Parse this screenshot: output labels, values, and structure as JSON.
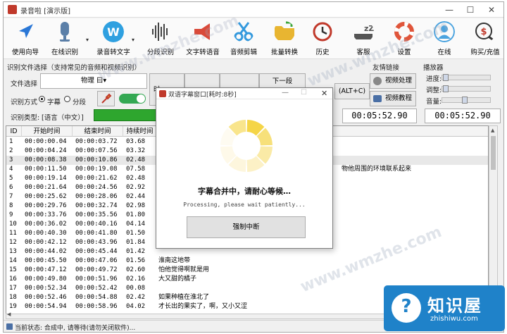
{
  "window": {
    "title": "录音啦 [演示版]",
    "controls": [
      "—",
      "☐",
      "✕"
    ]
  },
  "toolbar": [
    {
      "label": "使用向导",
      "color": "#2a77d6",
      "icon": "compass-icon"
    },
    {
      "label": "在线识别",
      "color": "#5b7fa8",
      "icon": "microphone-icon"
    },
    {
      "label": "录音转文字",
      "color": "#2fa0e0",
      "icon": "w-logo-icon"
    },
    {
      "label": "分段识别",
      "color": "#444444",
      "icon": "waveform-icon"
    },
    {
      "label": "文字转语音",
      "color": "#d94a3a",
      "icon": "megaphone-icon"
    },
    {
      "label": "音频剪辑",
      "color": "#3399dd",
      "icon": "scissors-icon"
    },
    {
      "label": "批量转换",
      "color": "#e8b531",
      "icon": "folder-icon"
    },
    {
      "label": "历史",
      "color": "#c0392b",
      "icon": "history-icon"
    },
    {
      "label": "客服",
      "color": "#555555",
      "icon": "sleep-zzz-icon"
    },
    {
      "label": "设置",
      "color": "#e0553a",
      "icon": "lifebuoy-icon"
    },
    {
      "label": "在线",
      "color": "#4aa3df",
      "icon": "user-icon"
    },
    {
      "label": "购买/充值",
      "color": "#c0392b",
      "icon": "payment-icon"
    }
  ],
  "panels": {
    "recognition_group": "识别文件选择（支持常见的音频和视频识别）",
    "file_label": "文件选择",
    "file_value": "物理 曰▾",
    "mode_label": "识别方式",
    "mode_subtitle": "字幕",
    "mode_segment": "分段",
    "type_label": "识别类型:",
    "type_value": "[语言（中文）]",
    "prev_btn": "下一段（ALT+X）",
    "next_btn": "(ALT+C)",
    "time_label": "时",
    "friends_group": "友情链接",
    "video_process": "视频处理",
    "video_tutorial": "视频教程",
    "player_group": "播放器",
    "progress_label": "进度:",
    "adjust_label": "调整:",
    "volume_label": "音量:",
    "time1": "00:05:52.90",
    "time2": "00:05:52.90"
  },
  "table": {
    "headers": [
      "ID",
      "开始时间",
      "结束时间",
      "持续时间"
    ],
    "rows": [
      [
        "1",
        "00:00:00.04",
        "00:00:03.72",
        "03.68",
        ""
      ],
      [
        "2",
        "00:00:04.24",
        "00:00:07.56",
        "03.32",
        ""
      ],
      [
        "3",
        "00:00:08.38",
        "00:00:10.86",
        "02.48",
        ""
      ],
      [
        "4",
        "00:00:11.50",
        "00:00:19.08",
        "07.58",
        "物他周围的环境联系起来"
      ],
      [
        "5",
        "00:00:19.14",
        "00:00:21.62",
        "02.48",
        ""
      ],
      [
        "6",
        "00:00:21.64",
        "00:00:24.56",
        "02.92",
        ""
      ],
      [
        "7",
        "00:00:25.62",
        "00:00:28.06",
        "02.44",
        ""
      ],
      [
        "8",
        "00:00:29.76",
        "00:00:32.74",
        "02.98",
        ""
      ],
      [
        "9",
        "00:00:33.76",
        "00:00:35.56",
        "01.80",
        ""
      ],
      [
        "10",
        "00:00:36.02",
        "00:00:40.16",
        "04.14",
        ""
      ],
      [
        "11",
        "00:00:40.30",
        "00:00:41.80",
        "01.50",
        ""
      ],
      [
        "12",
        "00:00:42.12",
        "00:00:43.96",
        "01.84",
        ""
      ],
      [
        "13",
        "00:00:44.02",
        "00:00:45.44",
        "01.42",
        ""
      ],
      [
        "14",
        "00:00:45.50",
        "00:00:47.06",
        "01.56",
        "淮南这地带"
      ],
      [
        "15",
        "00:00:47.12",
        "00:00:49.72",
        "02.60",
        "怕他觉得啊就是用"
      ],
      [
        "16",
        "00:00:49.80",
        "00:00:51.96",
        "02.16",
        "大又甜的橘子"
      ],
      [
        "17",
        "00:00:52.34",
        "00:00:52.42",
        "00.08",
        ""
      ],
      [
        "18",
        "00:00:52.46",
        "00:00:54.88",
        "02.42",
        "如果种植在淮北了"
      ],
      [
        "19",
        "00:00:54.94",
        "00:00:58.96",
        "04.02",
        "才长出的果实了，啊，又小又涩"
      ]
    ]
  },
  "status": {
    "text": "当前状态: 合成中, 请等待(请勿关闭软件)..."
  },
  "dialog": {
    "title": "双语字幕窗口[耗时:8秒]",
    "message": "字幕合并中，请耐心等候…",
    "english": "Processing, please wait patiently...",
    "button": "强制中断",
    "spinner_colors": [
      "#f5d547",
      "#f7e07a",
      "#faeaa6",
      "#fcf1c6",
      "#fdf6dd",
      "#fef9e9",
      "#fefbf1",
      "#f9e58c"
    ]
  },
  "watermarks": [
    "www.wmzhe.com"
  ],
  "logo": {
    "text": "知识屋",
    "url": "zhishiwu.com",
    "icon": "question-icon"
  }
}
